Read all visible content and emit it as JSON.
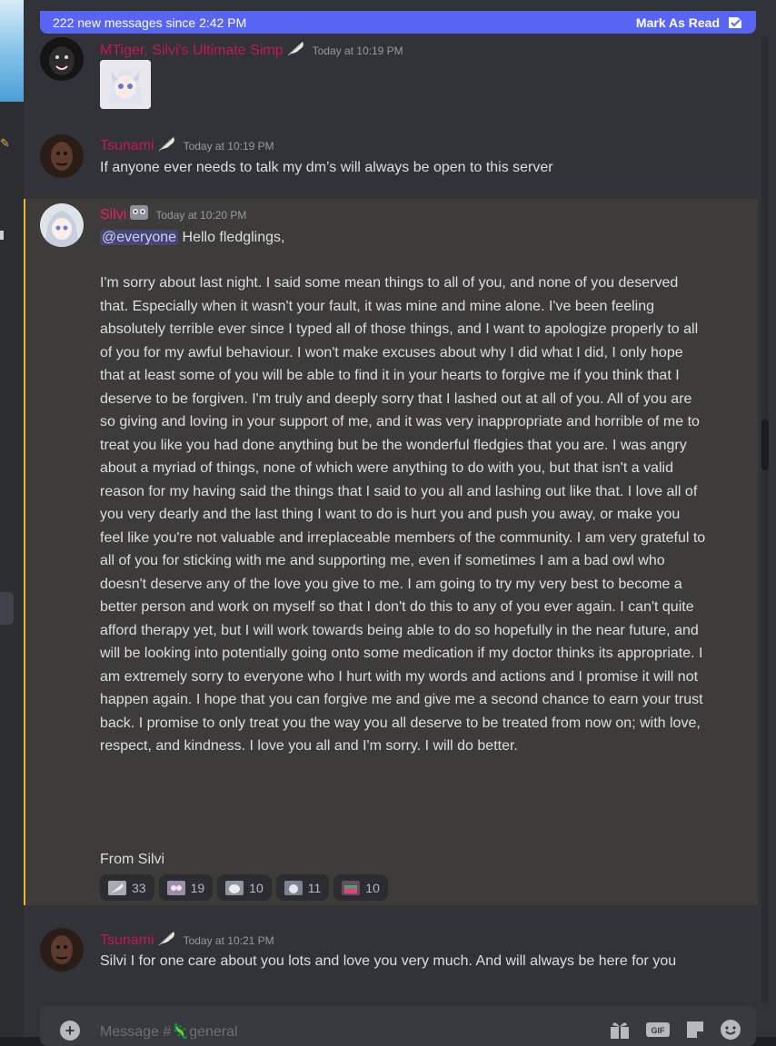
{
  "banner": {
    "new_messages": "222 new messages since 2:42 PM",
    "mark_read": "Mark As Read"
  },
  "messages": [
    {
      "author": "MTiger, Silvi's Ultimate Simp",
      "author_color": "#c2185b",
      "time": "Today at 10:19 PM",
      "text": ""
    },
    {
      "author": "Tsunami",
      "author_color": "#c2185b",
      "time": "Today at 10:19 PM",
      "text": "If anyone ever needs to talk my dm’s will always be open to this server"
    },
    {
      "author": "Silvi",
      "author_color": "#e91e63",
      "time": "Today at 10:20 PM",
      "mention": "@everyone",
      "greeting": " Hello fledglings,",
      "body": "I'm sorry about last night. I said some mean things to all of you, and none of you deserved that. Especially when it wasn't your fault, it was mine and mine alone. I've been feeling absolutely terrible ever since I typed all of those things, and I want to apologize properly to all of you for my awful behaviour. I won't make excuses about why I did what I did, I only hope that at least some of you will be able to find it in your hearts to forgive me if you think that I deserve to be forgiven. I'm truly and deeply sorry that I lashed out at all of you. All of you are so giving and loving in your support of me, and it was very inappropriate and horrible of me to treat you like you had done anything but be the wonderful fledgies that you are. I was angry about a myriad of things, none of which were anything to do with you, but that isn't a valid reason for my having said the things that I said to you all and lashing out like that. I love all of you very dearly and the last thing I want to do is hurt you and push you away, or make you feel like you're not valuable and irreplaceable members of the community. I am very grateful to all of you for sticking with me and supporting me, even if sometimes I am a bad owl who doesn't deserve any of the love you give to me. I am going to try my very best to become a better person and work on myself so that I don't do this to any of you ever again. I can't quite afford therapy yet, but I will work towards being able to do so hopefully in the near future, and will be looking into potentially going onto some medication if my doctor thinks its appropriate. I am extremely sorry to everyone who I hurt with my words and actions and I promise it will not happen again. I hope that you can forgive me and give me a second chance to earn your trust back. I promise to only treat you the way you all deserve to be treated from now on; with love, respect, and kindness. I love you all and I'm sorry. I will do better.",
      "signoff": "From Silvi",
      "reactions": [
        "33",
        "19",
        "10",
        "11",
        "10"
      ]
    },
    {
      "author": "Tsunami",
      "author_color": "#c2185b",
      "time": "Today at 10:21 PM",
      "text": "Silvi I for one care about you lots and love you very much. And will always be here for you"
    }
  ],
  "composer": {
    "placeholder_prefix": "Message #",
    "channel": "general"
  },
  "colors": {
    "accent": "#5865f2",
    "highlight_bar": "#f0b232"
  }
}
